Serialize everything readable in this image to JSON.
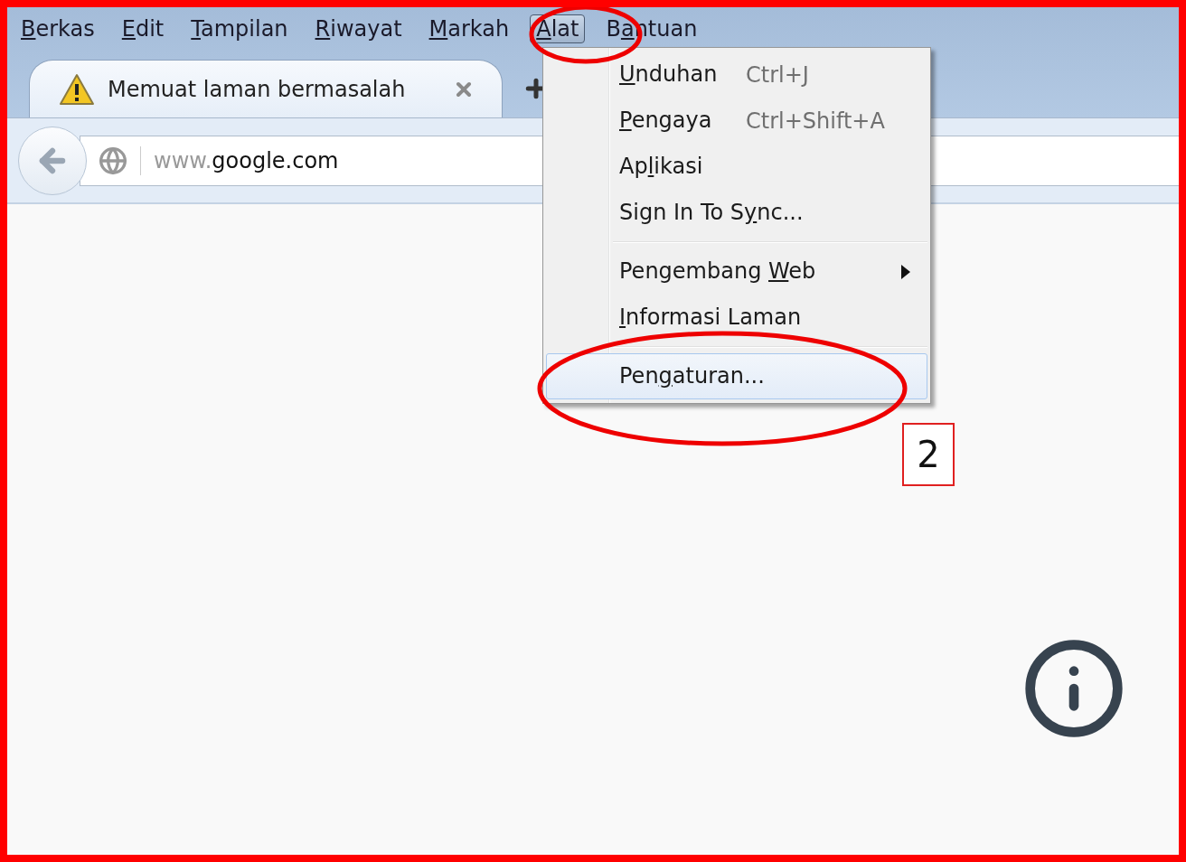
{
  "menu_bar": [
    {
      "label": {
        "key": "B",
        "after": "erkas"
      },
      "selected": false
    },
    {
      "label": {
        "key": "E",
        "after": "dit"
      },
      "selected": false
    },
    {
      "label": {
        "key": "T",
        "after": "ampilan"
      },
      "selected": false
    },
    {
      "label": {
        "key": "R",
        "after": "iwayat"
      },
      "selected": false
    },
    {
      "label": {
        "key": "M",
        "after": "arkah"
      },
      "selected": false
    },
    {
      "label": {
        "key": "A",
        "after": "lat"
      },
      "selected": true
    },
    {
      "label": {
        "before": "B",
        "key": "a",
        "after": "ntuan"
      },
      "selected": false
    }
  ],
  "tab": {
    "title": "Memuat laman bermasalah"
  },
  "address": {
    "dim": "www.",
    "main": "google.com"
  },
  "tools_menu": [
    {
      "kind": "item",
      "label": {
        "key": "U",
        "after": "nduhan"
      },
      "shortcut": "Ctrl+J",
      "selected": false,
      "submenu": false
    },
    {
      "kind": "item",
      "label": {
        "key": "P",
        "after": "engaya"
      },
      "shortcut": "Ctrl+Shift+A",
      "selected": false,
      "submenu": false
    },
    {
      "kind": "item",
      "label": {
        "before": "Ap",
        "key": "l",
        "after": "ikasi"
      },
      "selected": false,
      "submenu": false
    },
    {
      "kind": "item",
      "label": {
        "before": "Sign In To S",
        "key": "y",
        "after": "nc..."
      },
      "selected": false,
      "submenu": false
    },
    {
      "kind": "separator"
    },
    {
      "kind": "item",
      "label": {
        "before": "Pengembang ",
        "key": "W",
        "after": "eb"
      },
      "selected": false,
      "submenu": true
    },
    {
      "kind": "item",
      "label": {
        "key": "I",
        "after": "nformasi Laman"
      },
      "selected": false,
      "submenu": false
    },
    {
      "kind": "separator"
    },
    {
      "kind": "item",
      "label": {
        "before": "Pen",
        "key": "g",
        "after": "aturan..."
      },
      "selected": true,
      "submenu": false
    }
  ],
  "step_label": "2"
}
